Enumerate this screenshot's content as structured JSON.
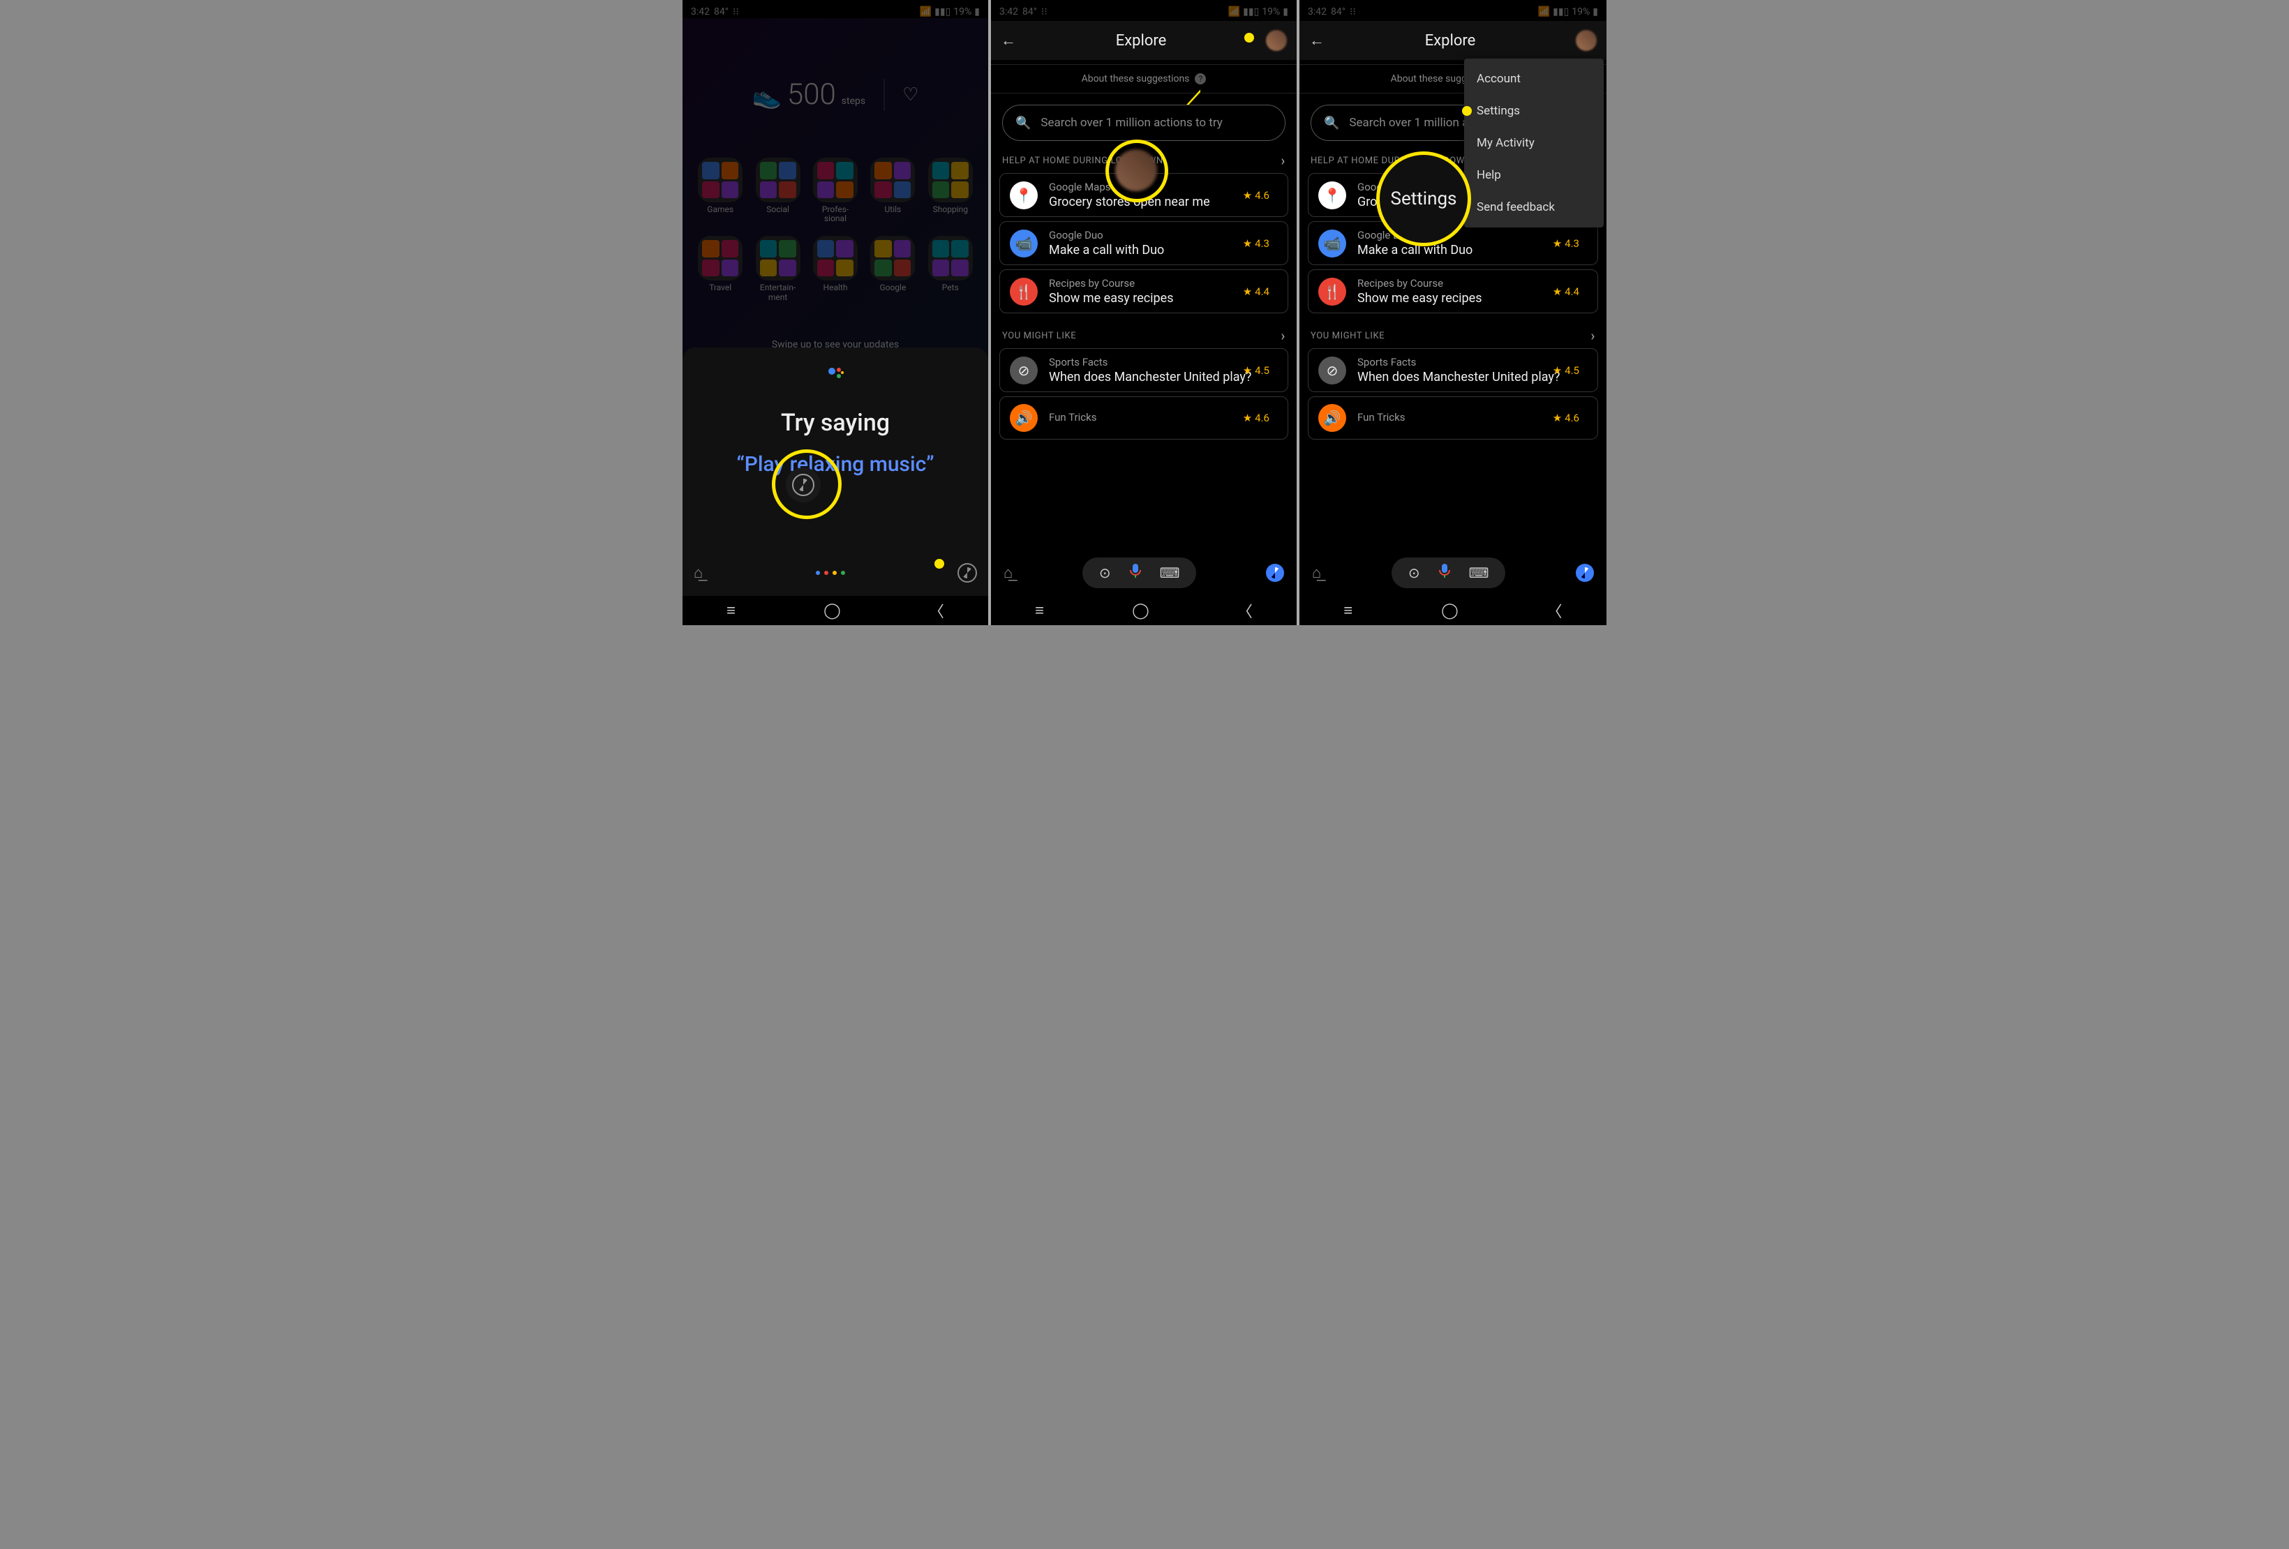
{
  "status": {
    "time": "3:42",
    "temp": "84°",
    "battery": "19%"
  },
  "s1": {
    "steps_n": "500",
    "steps_l": "steps",
    "apps_r1": [
      "Games",
      "Social",
      "Profes-\nsional",
      "Utils",
      "Shopping"
    ],
    "apps_r2": [
      "Travel",
      "Entertain-\nment",
      "Health",
      "Google",
      "Pets"
    ],
    "swipe": "Swipe up to see your updates",
    "try": "Try saying",
    "phrase": "“Play relaxing music”"
  },
  "explore": {
    "title": "Explore",
    "about": "About these suggestions",
    "search_ph": "Search over 1 million actions to try",
    "sec1": "HELP AT HOME DURING LOCKDOWN",
    "sec2": "YOU MIGHT LIKE",
    "cards": [
      {
        "sub": "Google Maps",
        "ttl": "Grocery stores open near me",
        "rating": "4.6"
      },
      {
        "sub": "Google Duo",
        "ttl": "Make a call with Duo",
        "rating": "4.3"
      },
      {
        "sub": "Recipes by Course",
        "ttl": "Show me easy recipes",
        "rating": "4.4"
      },
      {
        "sub": "Sports Facts",
        "ttl": "When does Manchester United play?",
        "rating": "4.5"
      },
      {
        "sub": "Fun Tricks",
        "ttl": "",
        "rating": "4.6"
      }
    ]
  },
  "menu": {
    "items": [
      "Account",
      "Settings",
      "My Activity",
      "Help",
      "Send feedback"
    ],
    "highlight": "Settings"
  }
}
